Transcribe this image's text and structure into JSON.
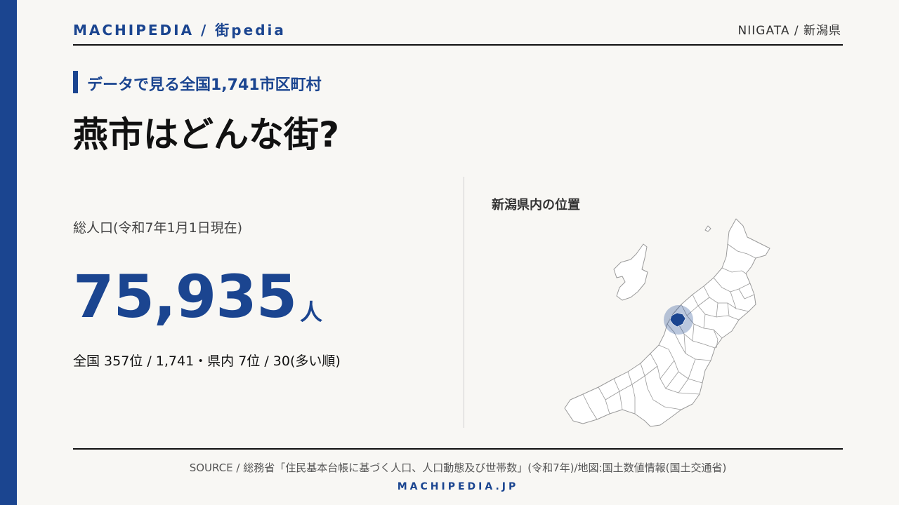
{
  "header": {
    "brand": "MACHIPEDIA / 街pedia",
    "region": "NIIGATA / 新潟県"
  },
  "hero": {
    "subtitle": "データで見る全国1,741市区町村",
    "title": "燕市はどんな街?"
  },
  "stat": {
    "label": "総人口(令和7年1月1日現在)",
    "value": "75,935",
    "unit": "人",
    "rank": "全国 357位 / 1,741・県内 7位 / 30(多い順)"
  },
  "map": {
    "title": "新潟県内の位置",
    "highlight_color": "#1b4590"
  },
  "footer": {
    "source": "SOURCE / 総務省「住民基本台帳に基づく人口、人口動態及び世帯数」(令和7年)/地図:国土数値情報(国土交通省)",
    "site": "MACHIPEDIA.JP"
  },
  "colors": {
    "accent": "#1b4590",
    "background": "#f8f7f4"
  }
}
